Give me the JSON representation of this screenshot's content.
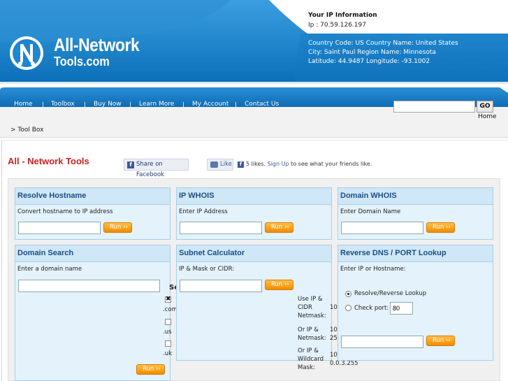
{
  "header": {
    "logo": {
      "line1": "All-Network",
      "line2": "Tools.com"
    },
    "ip_info": {
      "title": "Your IP Information",
      "ip_line": "Ip : 70.59.126.197",
      "country_line": "Country Code: US Country Name: United States",
      "city_line": "City: Saint Paul Region Name: Minnesota",
      "coords_line": "Latitude: 44.9487 Longitude: -93.1002"
    }
  },
  "nav": {
    "items": [
      "Home",
      "Toolbox",
      "Buy Now",
      "Learn More",
      "My Account",
      "Contact Us"
    ],
    "search": {
      "value": "",
      "go_label": "GO"
    },
    "home_link": "Home"
  },
  "breadcrumb": ">  Tool Box",
  "page": {
    "title": "All - Network Tools",
    "facebook": {
      "share_label": "Share on Facebook",
      "like_label": "Like",
      "likes_text": "5 likes.",
      "signup_text": "Sign Up",
      "signup_suffix": "to see what your friends like."
    }
  },
  "tools": {
    "run_label": "Run ››",
    "resolve": {
      "title": "Resolve Hostname",
      "desc": "Convert hostname to IP address"
    },
    "ipwhois": {
      "title": "IP WHOIS",
      "desc": "Enter IP Address"
    },
    "domainwhois": {
      "title": "Domain WHOIS",
      "desc": "Enter Domain Name"
    },
    "domainsearch": {
      "title": "Domain Search",
      "desc": "Enter a domain name",
      "select_label": "Se",
      "tlds": [
        ".com",
        ".us",
        ".uk"
      ]
    },
    "subnet": {
      "title": "Subnet Calculator",
      "desc": "IP & Mask or CIDR:",
      "rows": [
        {
          "label_lines": [
            "Use IP &",
            "CIDR",
            "Netmask:"
          ],
          "value_lines": [
            "10"
          ]
        },
        {
          "label_lines": [
            "Or IP &",
            "Netmask:"
          ],
          "value_lines": [
            "10",
            "25"
          ]
        },
        {
          "label_lines": [
            "Or IP &",
            "Wildcard",
            "Mask:"
          ],
          "value_lines": [
            "10",
            "0.0.3.255"
          ]
        }
      ]
    },
    "reversedns": {
      "title": "Reverse DNS / PORT Lookup",
      "desc": "Enter IP or Hostname:",
      "option_resolve": "Resolve/Reverse Lookup",
      "option_port": "Check port:",
      "port_value": "80"
    }
  }
}
